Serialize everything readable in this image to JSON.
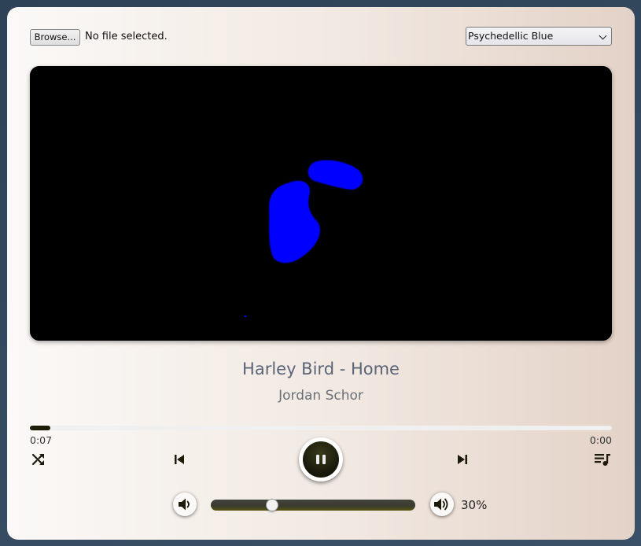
{
  "file_input": {
    "button_label": "Browse...",
    "status": "No file selected."
  },
  "theme": {
    "selected": "Psychedellic Blue"
  },
  "visualizer": {
    "background_color": "#000000",
    "shape_color": "#0000ff"
  },
  "track": {
    "title": "Harley Bird - Home",
    "artist": "Jordan Schor"
  },
  "playback": {
    "current_time": "0:07",
    "total_time": "0:00",
    "progress_fraction": 0.035,
    "state": "playing"
  },
  "controls": {
    "shuffle_icon": "shuffle-icon",
    "previous_icon": "skip-previous-icon",
    "pause_icon": "pause-icon",
    "next_icon": "skip-next-icon",
    "playlist_icon": "playlist-icon"
  },
  "volume": {
    "label": "30%",
    "level_fraction": 0.3,
    "down_icon": "volume-down-icon",
    "up_icon": "volume-up-icon"
  },
  "colors": {
    "accent_dark": "#1e1c08",
    "title_text": "#5a6478"
  }
}
